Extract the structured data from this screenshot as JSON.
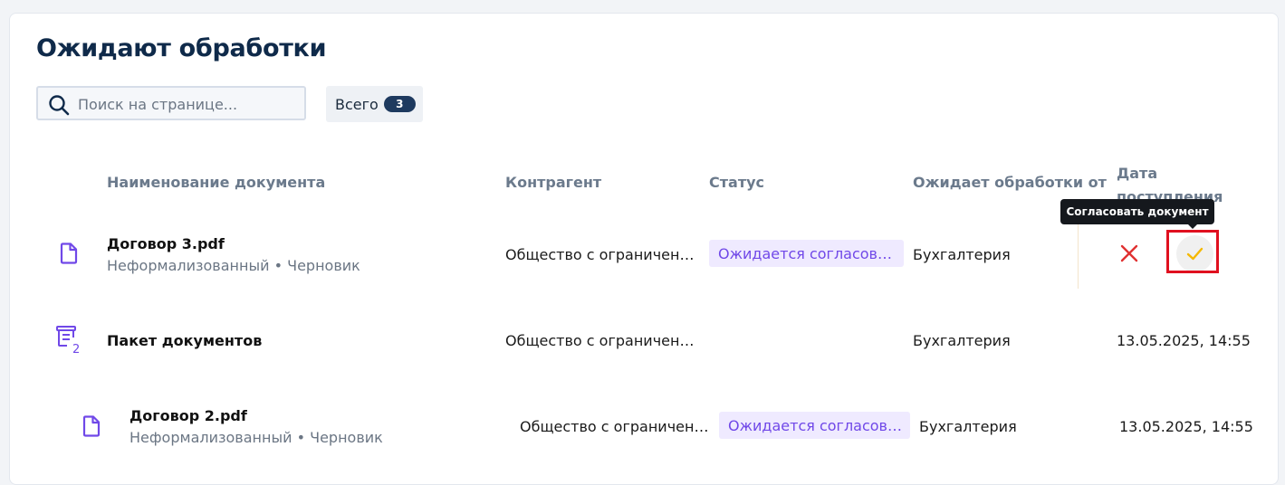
{
  "page": {
    "title": "Ожидают обработки"
  },
  "search": {
    "placeholder": "Поиск на странице..."
  },
  "total": {
    "label": "Всего",
    "count": "3"
  },
  "columns": {
    "name": "Наименование документа",
    "counterparty": "Контрагент",
    "status": "Статус",
    "awaiting": "Ожидает обработки от",
    "date": "Дата поступления"
  },
  "rows": [
    {
      "name": "Договор 3.pdf",
      "subtitle": "Неформализованный • Черновик",
      "counterparty": "Общество с ограничен…",
      "status": "Ожидается согласов…",
      "awaiting": "Бухгалтерия",
      "date": "",
      "icon": "file-icon"
    },
    {
      "name": "Пакет документов",
      "subtitle": "",
      "counterparty": "Общество с ограничен…",
      "status": "",
      "awaiting": "Бухгалтерия",
      "date": "13.05.2025, 14:55",
      "icon": "package-icon",
      "package_count": "2"
    },
    {
      "name": "Договор 2.pdf",
      "subtitle": "Неформализованный • Черновик",
      "counterparty": "Общество с ограничен…",
      "status": "Ожидается согласов…",
      "awaiting": "Бухгалтерия",
      "date": "13.05.2025, 14:55",
      "icon": "file-icon"
    }
  ],
  "actions": {
    "tooltip": "Согласовать документ",
    "reject_icon": "close-icon",
    "approve_icon": "check-icon"
  },
  "colors": {
    "accent": "#7048e8",
    "status_bg": "#efeaff",
    "reject": "#e03131",
    "approve": "#f5b800",
    "highlight": "#e0101f",
    "title": "#0f2a4a"
  }
}
